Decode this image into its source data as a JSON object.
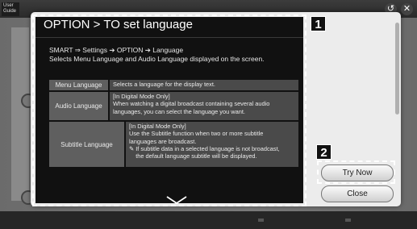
{
  "app": {
    "badge": "User Guide"
  },
  "dialog": {
    "title": "OPTION > TO set language",
    "nav_path": "SMART ⇒ Settings ➔ OPTION ➔ Language",
    "description": "Selects Menu Language and Audio Language displayed on the screen.",
    "table": [
      {
        "key": "Menu Language",
        "lines": [
          "Selects a language for the display text."
        ]
      },
      {
        "key": "Audio Language",
        "lines": [
          "[In Digital Mode Only]",
          "When watching a digital broadcast containing several audio",
          "languages, you can select the language you want."
        ]
      },
      {
        "key": "Subtitle Language",
        "lines": [
          "[In Digital Mode Only]",
          "Use the Subtitle function when two or more subtitle",
          "languages are broadcast.",
          "✎ If subtitle data in a selected language is not broadcast,",
          "    the default language subtitle will be displayed."
        ]
      }
    ]
  },
  "callouts": {
    "one": "1",
    "two": "2"
  },
  "buttons": {
    "try_now": "Try Now",
    "close": "Close"
  },
  "icons": {
    "back": "back-icon",
    "close": "close-icon",
    "scroll_down": "chevron-down-icon"
  }
}
